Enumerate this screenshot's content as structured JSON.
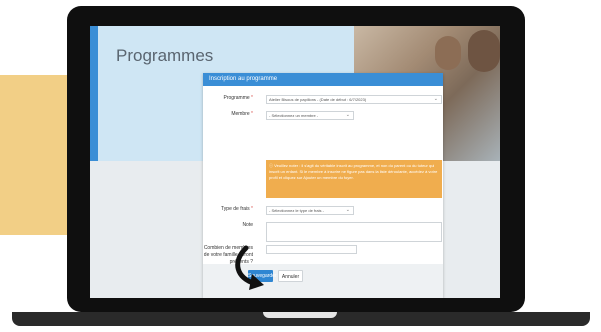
{
  "page": {
    "title": "Programmes"
  },
  "modal": {
    "header": "Inscription au programme",
    "program_label": "Programme",
    "required_marker": "*",
    "program_value": "Atelier Bisous de papillons - (Date de début : 6/7/2023)",
    "member_label": "Membre",
    "member_value": "- Sélectionnez un membre -",
    "alert_text": "Veuillez noter : il s'agit du véritable inscrit au programme, et non du parent ou du tuteur qui inscrit un enfant. Si le membre à inscrire ne figure pas dans la liste déroulante, accédez à votre profil et cliquez sur Ajouter un membre du foyer.",
    "fee_label": "Type de frais",
    "fee_value": "- Sélectionnez le type de frais -",
    "note_label": "Note",
    "count_label": "Combien de membres de votre famille seront présents ?",
    "save_label": "Sauvegarder",
    "cancel_label": "Annuler"
  }
}
